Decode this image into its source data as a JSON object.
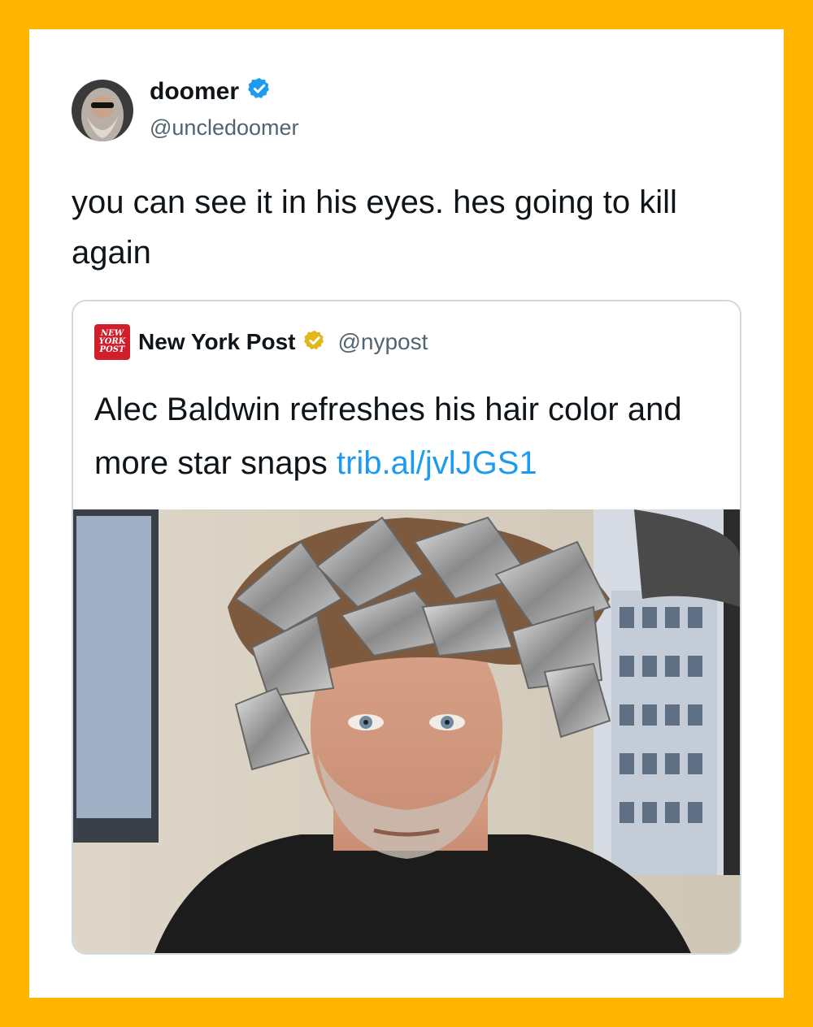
{
  "author": {
    "display_name": "doomer",
    "handle": "@uncledoomer",
    "verified_icon": "verified-badge-icon",
    "badge_color": "#1D9BF0"
  },
  "tweet": {
    "text": "you can see it in his eyes. hes going to kill again"
  },
  "quoted_tweet": {
    "logo_lines": [
      "NEW",
      "YORK",
      "POST"
    ],
    "display_name": "New York Post",
    "handle": "@nypost",
    "verified_icon": "gold-verified-badge-icon",
    "badge_color": "#E2B719",
    "text": "Alec Baldwin refreshes his hair color and more star snaps ",
    "link": "trib.al/jvlJGS1",
    "link_color": "#1D9BF0",
    "media": "photo-man-with-foil-hair-icon"
  },
  "colors": {
    "frame": "#FFB500",
    "card": "#FFFFFF"
  }
}
